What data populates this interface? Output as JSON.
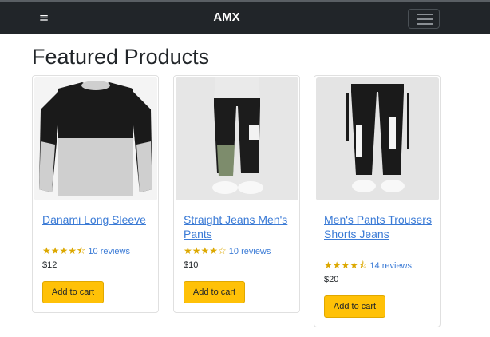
{
  "navbar": {
    "brand": "AMX",
    "menu_glyph": "≡",
    "toggler_icon": "hamburger-icon"
  },
  "page": {
    "title": "Featured Products"
  },
  "colors": {
    "navbar_bg": "#212529",
    "link": "#3b7bd6",
    "star": "#dca800",
    "button_bg": "#ffc107"
  },
  "products": [
    {
      "name": "Danami Long Sleeve",
      "rating": 4.5,
      "stars": "★★★★⯪",
      "reviews": "10 reviews",
      "price": "$12",
      "button": "Add to cart"
    },
    {
      "name": "Straight Jeans Men's Pants",
      "rating": 4,
      "stars": "★★★★☆",
      "reviews": "10 reviews",
      "price": "$10",
      "button": "Add to cart"
    },
    {
      "name": "Men's Pants Trousers Shorts Jeans",
      "rating": 4.5,
      "stars": "★★★★⯪",
      "reviews": "14 reviews",
      "price": "$20",
      "button": "Add to cart"
    }
  ]
}
